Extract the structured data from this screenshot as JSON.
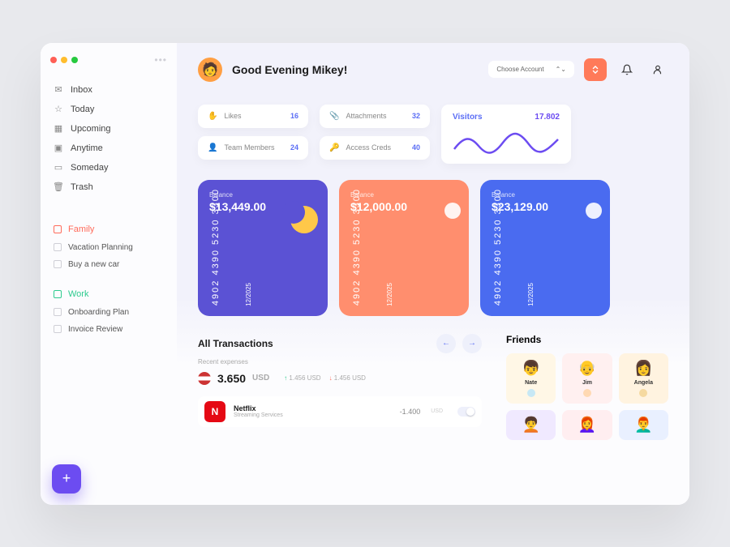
{
  "sidebar": {
    "items": [
      {
        "label": "Inbox",
        "icon": "inbox"
      },
      {
        "label": "Today",
        "icon": "star"
      },
      {
        "label": "Upcoming",
        "icon": "calendar"
      },
      {
        "label": "Anytime",
        "icon": "layers"
      },
      {
        "label": "Someday",
        "icon": "archive"
      },
      {
        "label": "Trash",
        "icon": "trash"
      }
    ],
    "projects": {
      "family": {
        "label": "Family",
        "items": [
          "Vacation Planning",
          "Buy a new car"
        ]
      },
      "work": {
        "label": "Work",
        "items": [
          "Onboarding Plan",
          "Invoice Review"
        ]
      }
    }
  },
  "header": {
    "greeting": "Good Evening Mikey!",
    "account_selector": "Choose Account"
  },
  "stats": [
    {
      "label": "Likes",
      "value": "16"
    },
    {
      "label": "Attachments",
      "value": "32"
    },
    {
      "label": "Team Members",
      "value": "24"
    },
    {
      "label": "Access Creds",
      "value": "40"
    }
  ],
  "visitors": {
    "label": "Visitors",
    "value": "17.802"
  },
  "cards": [
    {
      "balance_label": "Balance",
      "balance": "$13,449.00",
      "number": "4902 4390 5230 3300",
      "exp": "12/2025"
    },
    {
      "balance_label": "Balance",
      "balance": "$12,000.00",
      "number": "4902 4390 5230 3300",
      "exp": "12/2025"
    },
    {
      "balance_label": "Balance",
      "balance": "$23,129.00",
      "number": "4902 4390 5230 3300",
      "exp": "12/2025"
    }
  ],
  "transactions": {
    "heading": "All Transactions",
    "recent_label": "Recent expenses",
    "total": "3.650",
    "currency": "USD",
    "inflow": "1.456",
    "outflow": "1.456",
    "flow_currency": "USD",
    "items": [
      {
        "name": "Netflix",
        "category": "Streaming Services",
        "amount": "-1.400",
        "currency": "USD"
      }
    ]
  },
  "friends": {
    "heading": "Friends",
    "list": [
      {
        "name": "Nate",
        "emoji": "👦"
      },
      {
        "name": "Jim",
        "emoji": "👴"
      },
      {
        "name": "Angela",
        "emoji": "👩"
      },
      {
        "name": "",
        "emoji": "🧑‍🦱"
      },
      {
        "name": "",
        "emoji": "👩‍🦰"
      },
      {
        "name": "",
        "emoji": "👨‍🦰"
      }
    ]
  }
}
